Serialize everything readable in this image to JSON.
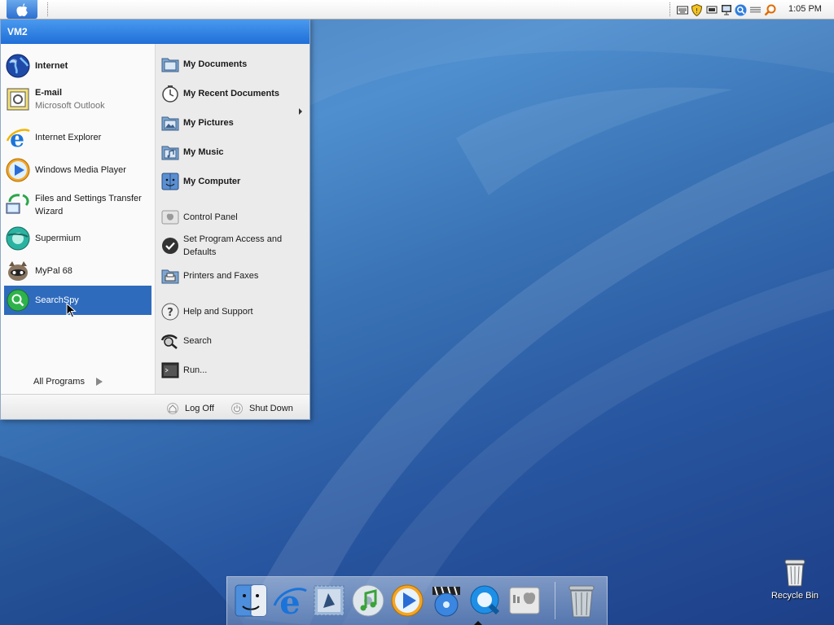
{
  "menubar": {
    "apple_icon": "apple-logo-icon",
    "tray_icons": [
      "keyboard-icon",
      "security-shield-icon",
      "battery-icon",
      "network-icon",
      "search-icon",
      "volume-icon",
      "spotlight-icon"
    ],
    "clock": "1:05 PM"
  },
  "start_menu": {
    "user": "VM2",
    "pinned": [
      {
        "label": "Internet",
        "icon": "globe-icon"
      },
      {
        "label": "E-mail",
        "sublabel": "Microsoft Outlook",
        "icon": "mail-icon"
      }
    ],
    "recent": [
      {
        "label": "Internet Explorer",
        "icon": "internet-explorer-icon"
      },
      {
        "label": "Windows Media Player",
        "icon": "media-player-icon"
      },
      {
        "label": "Files and Settings Transfer Wizard",
        "icon": "transfer-wizard-icon"
      },
      {
        "label": "Supermium",
        "icon": "supermium-icon"
      },
      {
        "label": "MyPal 68",
        "icon": "mypal-icon"
      },
      {
        "label": "SearchSpy",
        "icon": "searchspy-icon"
      }
    ],
    "all_programs": "All Programs",
    "places": [
      {
        "label": "My Documents",
        "icon": "documents-folder-icon"
      },
      {
        "label": "My Recent Documents",
        "icon": "recent-documents-icon"
      },
      {
        "label": "My Pictures",
        "icon": "pictures-folder-icon"
      },
      {
        "label": "My Music",
        "icon": "music-folder-icon"
      },
      {
        "label": "My Computer",
        "icon": "computer-icon"
      }
    ],
    "system": [
      {
        "label": "Control Panel",
        "icon": "control-panel-icon"
      },
      {
        "label": "Set Program Access and Defaults",
        "icon": "checkmark-icon"
      },
      {
        "label": "Printers and Faxes",
        "icon": "printer-icon"
      },
      {
        "label": "Help and Support",
        "icon": "help-icon"
      },
      {
        "label": "Search",
        "icon": "search-icon"
      },
      {
        "label": "Run...",
        "icon": "run-icon"
      }
    ],
    "log_off": "Log Off",
    "shut_down": "Shut Down"
  },
  "dock": {
    "items": [
      "finder-icon",
      "internet-explorer-icon",
      "mail-icon",
      "itunes-icon",
      "media-player-icon",
      "dvd-player-icon",
      "quicktime-icon",
      "control-panel-icon",
      "trash-icon"
    ]
  },
  "desktop": {
    "recycle_bin": "Recycle Bin"
  },
  "colors": {
    "selection": "#2f6bbd",
    "header": "#1f6fd8",
    "desktop": "#2856a0"
  }
}
